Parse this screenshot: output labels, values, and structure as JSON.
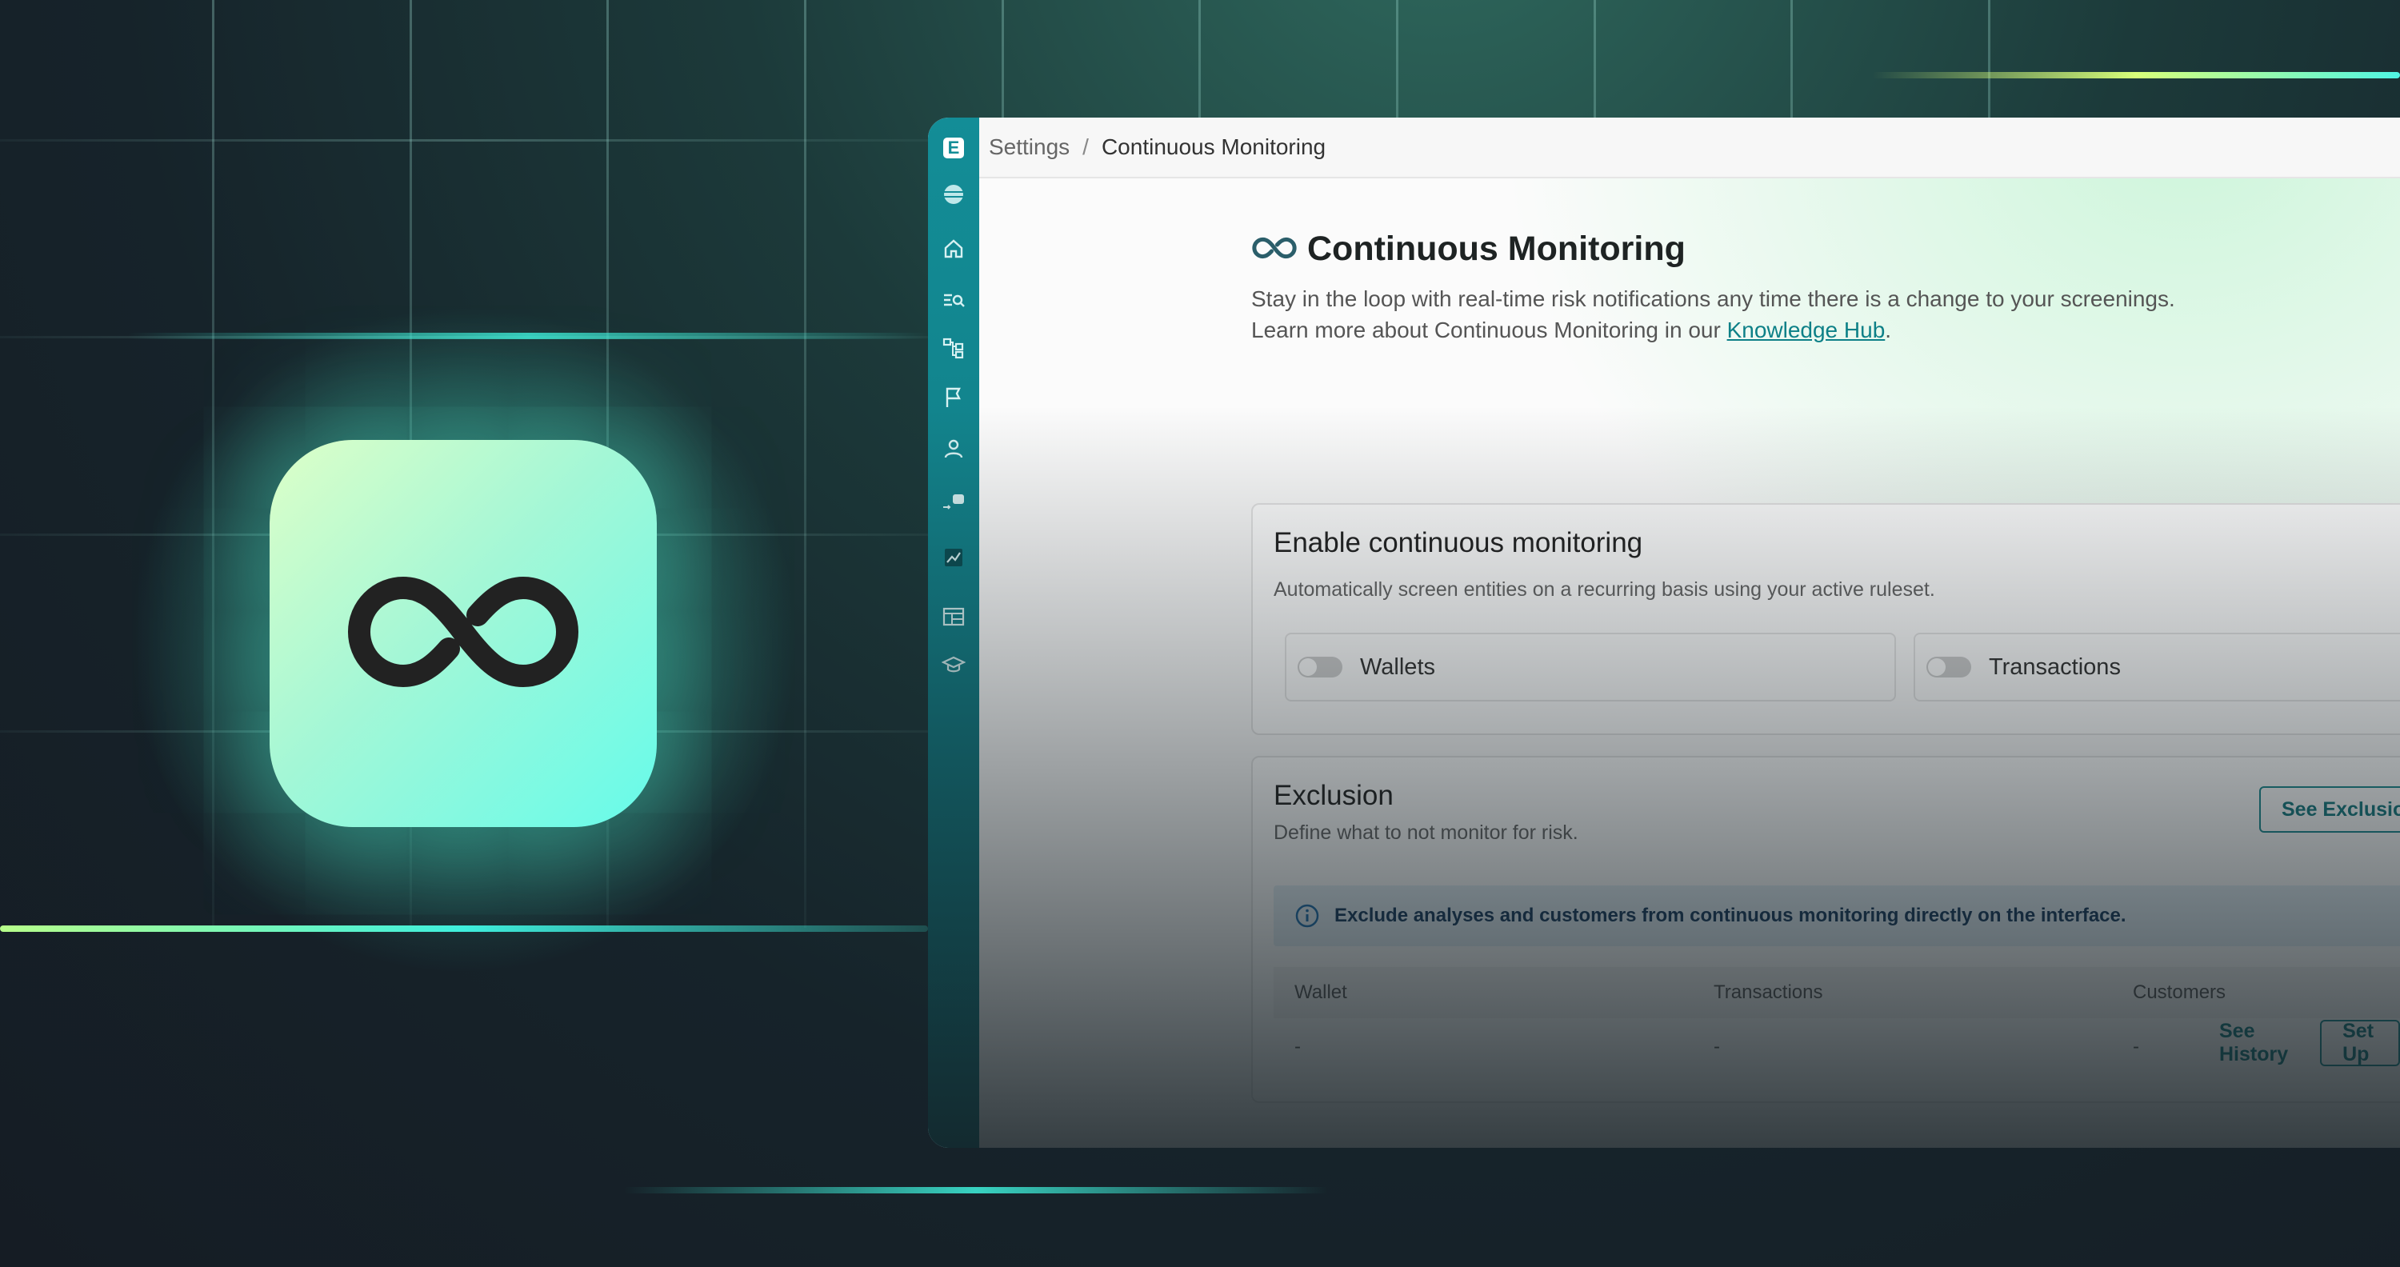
{
  "breadcrumb": {
    "parent": "Settings",
    "separator": "/",
    "current": "Continuous Monitoring"
  },
  "page": {
    "title": "Continuous Monitoring",
    "description_line1": "Stay in the loop with real-time risk notifications any time there is a change to your screenings.",
    "description_line2_prefix": "Learn more about Continuous Monitoring in our ",
    "knowledge_link": "Knowledge Hub",
    "description_line2_suffix": "."
  },
  "enable_card": {
    "title": "Enable continuous monitoring",
    "subtitle": "Automatically screen entities on a recurring basis using your active ruleset.",
    "toggles": [
      {
        "label": "Wallets",
        "on": false
      },
      {
        "label": "Transactions",
        "on": false
      }
    ]
  },
  "exclusion_card": {
    "title": "Exclusion",
    "subtitle": "Define what to not monitor for risk.",
    "button_label": "See Exclusio",
    "info_text": "Exclude analyses and customers from continuous monitoring directly on the interface.",
    "columns": [
      "Wallet",
      "Transactions",
      "Customers"
    ],
    "row": [
      "-",
      "-",
      "-"
    ]
  },
  "footer": {
    "history_label": "See History",
    "setup_label": "Set Up"
  },
  "sidebar": {
    "logo_letter": "E",
    "icons": [
      "globe-icon",
      "home-icon",
      "search-list-icon",
      "graph-icon",
      "flag-icon",
      "user-icon",
      "transfer-icon",
      "chart-icon",
      "table-icon",
      "education-icon"
    ]
  },
  "colors": {
    "accent": "#138d97",
    "tile_gradient_start": "#ddffc8",
    "tile_gradient_end": "#66fbea"
  }
}
